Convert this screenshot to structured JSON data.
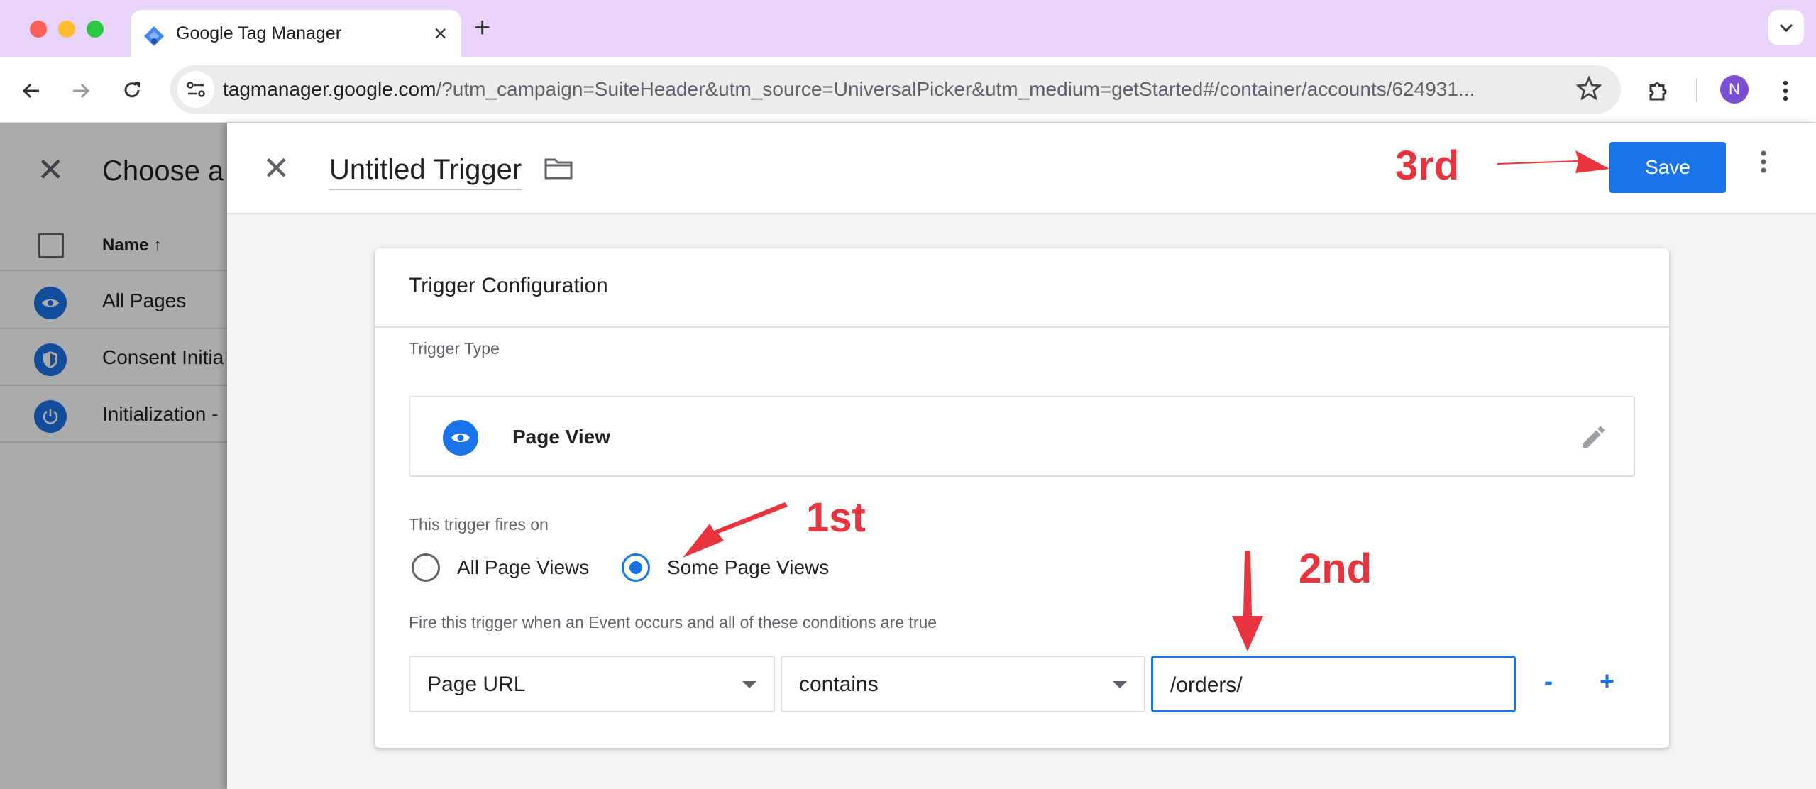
{
  "browser": {
    "tab_title": "Google Tag Manager",
    "new_tab_label": "+",
    "url_host": "tagmanager.google.com",
    "url_rest": "/?utm_campaign=SuiteHeader&utm_source=UniversalPicker&utm_medium=getStarted#/container/accounts/624931...",
    "profile_initial": "N",
    "colors": {
      "tab_strip": "#e8d4fa",
      "profile": "#7b4fd3"
    }
  },
  "background_panel": {
    "title": "Choose a",
    "column_name": "Name",
    "rows": [
      {
        "label": "All Pages",
        "icon": "eye-icon"
      },
      {
        "label": "Consent Initia",
        "icon": "shield-icon"
      },
      {
        "label": "Initialization -",
        "icon": "power-icon"
      }
    ]
  },
  "editor": {
    "trigger_name": "Untitled Trigger",
    "save_label": "Save",
    "accent": "#1a73e8"
  },
  "config": {
    "title": "Trigger Configuration",
    "trigger_type_label": "Trigger Type",
    "trigger_type": "Page View",
    "fires_on_label": "This trigger fires on",
    "option_all": "All Page Views",
    "option_some": "Some Page Views",
    "selected_option": "Some Page Views",
    "condition_label": "Fire this trigger when an Event occurs and all of these conditions are true",
    "condition_variable": "Page URL",
    "condition_operator": "contains",
    "condition_value": "/orders/",
    "remove_label": "-",
    "add_label": "+"
  },
  "annotations": {
    "first": "1st",
    "second": "2nd",
    "third": "3rd",
    "color": "#e8343f"
  }
}
